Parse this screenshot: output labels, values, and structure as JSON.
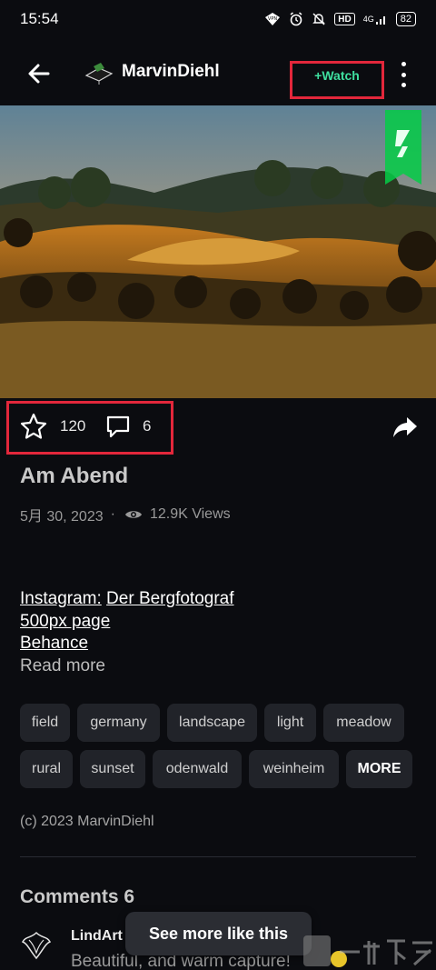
{
  "status": {
    "time": "15:54",
    "hd": "HD",
    "signal": "4G",
    "battery": "82"
  },
  "header": {
    "username": "MarvinDiehl",
    "watch_label": "+Watch"
  },
  "actions": {
    "favorites": "120",
    "comments": "6"
  },
  "deviation": {
    "title": "Am Abend",
    "date": "5月 30, 2023",
    "separator": "·",
    "views": "12.9K Views"
  },
  "description": {
    "instagram_label": "Instagram:",
    "instagram_link": "Der Bergfotograf",
    "px_link": "500px page",
    "behance_link": "Behance",
    "read_more": "Read more"
  },
  "tags": [
    "field",
    "germany",
    "landscape",
    "light",
    "meadow",
    "rural",
    "sunset",
    "odenwald",
    "weinheim"
  ],
  "tags_more": "MORE",
  "copyright": "(c) 2023 MarvinDiehl",
  "comments": {
    "header": "Comments 6",
    "first_author": "LindArt",
    "first_text": "Beautiful, and warm capture!"
  },
  "see_more": "See more like this",
  "colors": {
    "accent_green": "#3fe0a0",
    "highlight_red": "#e3273b",
    "background": "#0b0c10"
  }
}
